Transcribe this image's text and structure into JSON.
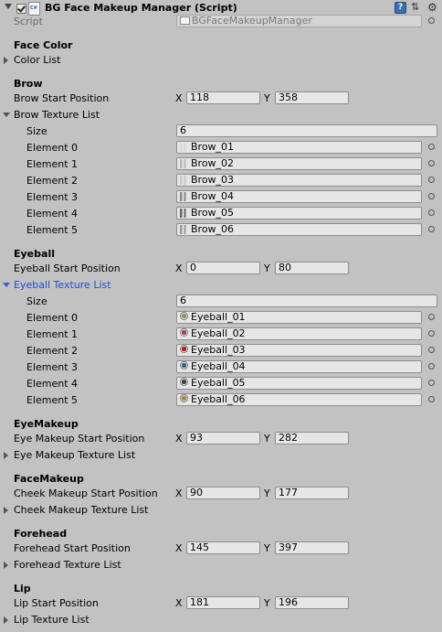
{
  "header": {
    "title": "BG Face Makeup Manager (Script)"
  },
  "script": {
    "label": "Script",
    "value": "BGFaceMakeupManager"
  },
  "face_color": {
    "title": "Face Color",
    "color_list": "Color List"
  },
  "brow": {
    "title": "Brow",
    "start_label": "Brow Start Position",
    "x": "118",
    "y": "358",
    "list_label": "Brow Texture List",
    "size_label": "Size",
    "size": "6",
    "elements": [
      {
        "label": "Element 0",
        "value": "Brow_01"
      },
      {
        "label": "Element 1",
        "value": "Brow_02"
      },
      {
        "label": "Element 2",
        "value": "Brow_03"
      },
      {
        "label": "Element 3",
        "value": "Brow_04"
      },
      {
        "label": "Element 4",
        "value": "Brow_05"
      },
      {
        "label": "Element 5",
        "value": "Brow_06"
      }
    ]
  },
  "eyeball": {
    "title": "Eyeball",
    "start_label": "Eyeball Start Position",
    "x": "0",
    "y": "80",
    "list_label": "Eyeball Texture List",
    "size_label": "Size",
    "size": "6",
    "elements": [
      {
        "label": "Element 0",
        "value": "Eyeball_01",
        "color": "#9a8a6a"
      },
      {
        "label": "Element 1",
        "value": "Eyeball_02",
        "color": "#a04050"
      },
      {
        "label": "Element 2",
        "value": "Eyeball_03",
        "color": "#c01020"
      },
      {
        "label": "Element 3",
        "value": "Eyeball_04",
        "color": "#3a6070"
      },
      {
        "label": "Element 4",
        "value": "Eyeball_05",
        "color": "#503a2a"
      },
      {
        "label": "Element 5",
        "value": "Eyeball_06",
        "color": "#a08a3a"
      }
    ]
  },
  "eyemakeup": {
    "title": "EyeMakeup",
    "start_label": "Eye Makeup Start Position",
    "x": "93",
    "y": "282",
    "list_label": "Eye Makeup Texture List"
  },
  "facemakeup": {
    "title": "FaceMakeup",
    "start_label": "Cheek Makeup Start Position",
    "x": "90",
    "y": "177",
    "list_label": "Cheek Makeup Texture List"
  },
  "forehead": {
    "title": "Forehead",
    "start_label": "Forehead Start Position",
    "x": "145",
    "y": "397",
    "list_label": "Forehead Texture List"
  },
  "lip": {
    "title": "Lip",
    "start_label": "Lip Start Position",
    "x": "181",
    "y": "196",
    "list_label": "Lip Texture List"
  },
  "axis": {
    "x": "X",
    "y": "Y"
  }
}
